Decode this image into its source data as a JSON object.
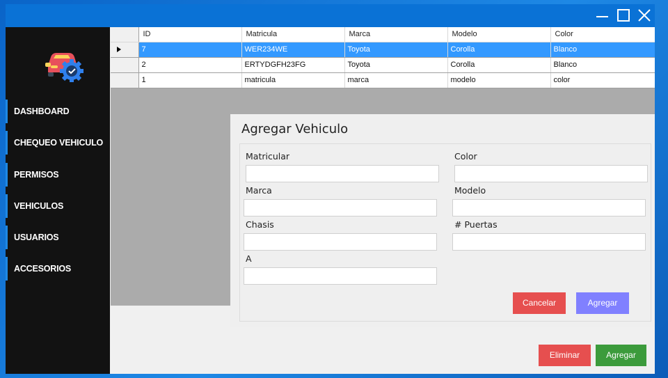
{
  "colors": {
    "titlebar": "#0a72d6",
    "sidebar": "#121212",
    "nav_accent": "#1e88e5",
    "row_selected": "#3399ff",
    "cancel": "#e64f4f",
    "agregar_dialog": "#8080ff",
    "eliminar": "#e64f4f",
    "agregar_main": "#3c9b3c"
  },
  "titlebar": {
    "minimize_icon": "minimize-icon",
    "maximize_icon": "maximize-icon",
    "close_icon": "close-icon"
  },
  "sidebar": {
    "logo_icon": "car-gear-icon",
    "items": [
      {
        "label": "DASHBOARD"
      },
      {
        "label": "CHEQUEO VEHICULO"
      },
      {
        "label": "PERMISOS"
      },
      {
        "label": "VEHICULOS"
      },
      {
        "label": "USUARIOS"
      },
      {
        "label": "ACCESORIOS"
      }
    ]
  },
  "grid": {
    "columns": [
      "ID",
      "Matricula",
      "Marca",
      "Modelo",
      "Color"
    ],
    "rows": [
      [
        "7",
        "WER234WE",
        "Toyota",
        "Corolla",
        "Blanco"
      ],
      [
        "2",
        "ERTYDGFH23FG",
        "Toyota",
        "Corolla",
        "Blanco"
      ],
      [
        "1",
        "matricula",
        "marca",
        "modelo",
        "color"
      ]
    ],
    "selected_row": 0
  },
  "dialog": {
    "title": "Agregar Vehiculo",
    "fields": {
      "matricula": {
        "label": "Matricular",
        "value": ""
      },
      "color": {
        "label": "Color",
        "value": ""
      },
      "marca": {
        "label": "Marca",
        "value": ""
      },
      "modelo": {
        "label": "Modelo",
        "value": ""
      },
      "chasis": {
        "label": "Chasis",
        "value": ""
      },
      "puertas": {
        "label": "# Puertas",
        "value": ""
      },
      "a": {
        "label": "A",
        "value": ""
      }
    },
    "cancel_label": "Cancelar",
    "agregar_label": "Agregar"
  },
  "actions": {
    "eliminar_label": "Eliminar",
    "agregar_label": "Agregar"
  }
}
